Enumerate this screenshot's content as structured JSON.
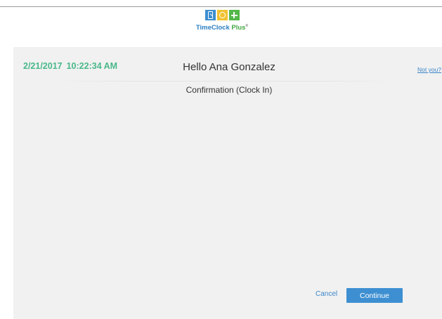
{
  "brand": {
    "name_part1": "TimeClock",
    "name_part2": "Plus",
    "trademark": "®"
  },
  "header": {
    "date": "2/21/2017",
    "time": "10:22:34 AM",
    "greeting": "Hello Ana Gonzalez",
    "not_you_label": "Not you?"
  },
  "main": {
    "subtitle": "Confirmation (Clock In)"
  },
  "actions": {
    "cancel_label": "Cancel",
    "continue_label": "Continue"
  },
  "colors": {
    "accent_blue": "#3d8fd1",
    "timestamp_green": "#4ab88a",
    "panel_bg": "#f1f1f1"
  }
}
